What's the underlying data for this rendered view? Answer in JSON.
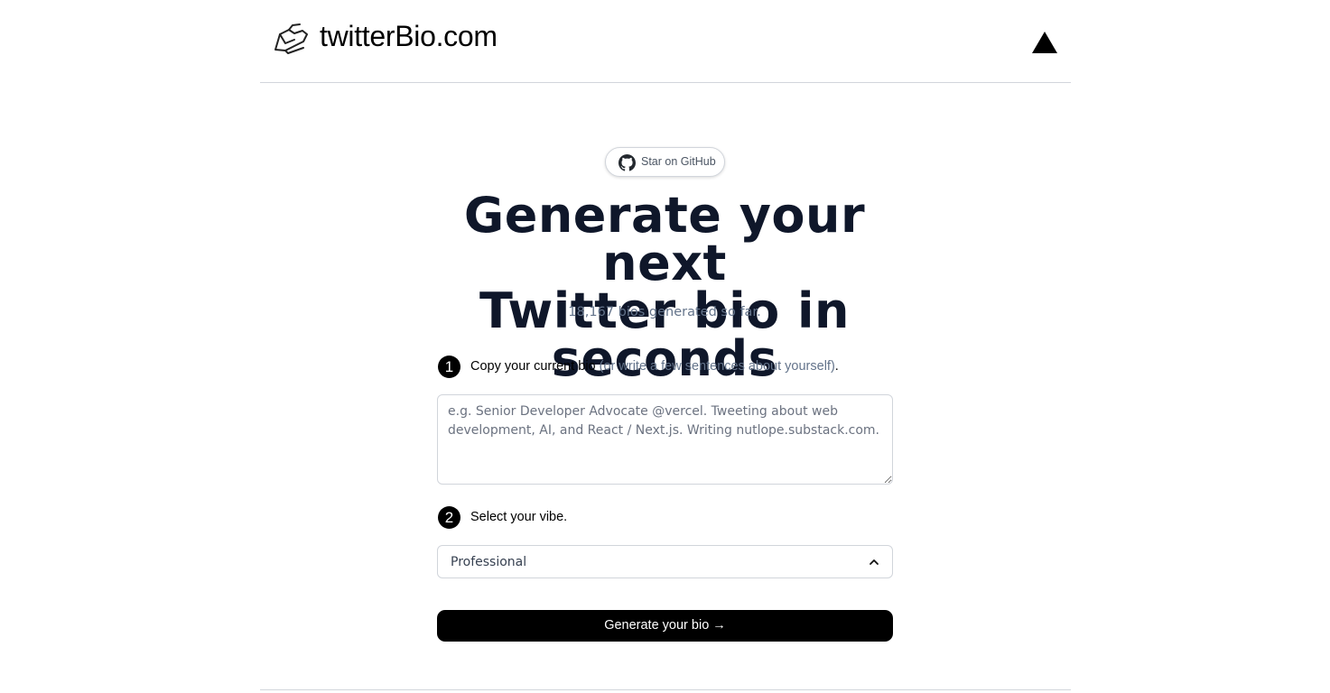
{
  "header": {
    "brand": "twitterBio.com",
    "logo_icon": "writing-hand-icon",
    "right_icon": "vercel-triangle-icon"
  },
  "github": {
    "label": "Star on GitHub",
    "icon": "github-icon"
  },
  "hero": {
    "title_line1": "Generate your next",
    "title_line2": "Twitter bio in seconds",
    "subtitle": "18,167 bios generated so far."
  },
  "step1": {
    "number": "1",
    "text": "Copy your current bio",
    "muted": "(or write a few sentences about yourself)",
    "period": ".",
    "placeholder": "e.g. Senior Developer Advocate @vercel. Tweeting about web development, AI, and React / Next.js. Writing nutlope.substack.com.",
    "value": ""
  },
  "step2": {
    "number": "2",
    "text": "Select your vibe.",
    "selected": "Professional"
  },
  "generate_button": {
    "label": "Generate your bio →"
  },
  "colors": {
    "text": "#0f172a",
    "muted": "#64748b",
    "border": "#d1d5db",
    "button": "#000000"
  }
}
